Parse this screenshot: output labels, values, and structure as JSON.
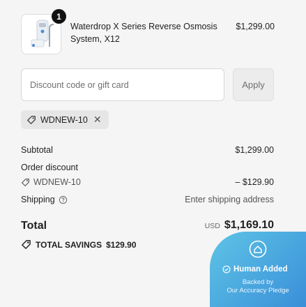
{
  "product": {
    "quantity": "1",
    "name": "Waterdrop X Series Reverse Osmosis System, X12",
    "price": "$1,299.00"
  },
  "discount": {
    "placeholder": "Discount code or gift card",
    "apply_label": "Apply",
    "applied_code": "WDNEW-10",
    "remove_glyph": "✕"
  },
  "summary": {
    "subtotal_label": "Subtotal",
    "subtotal_value": "$1,299.00",
    "order_discount_label": "Order discount",
    "discount_code": "WDNEW-10",
    "discount_value": "– $129.90",
    "shipping_label": "Shipping",
    "shipping_value": "Enter shipping address",
    "total_label": "Total",
    "total_currency": "USD",
    "total_value": "$1,169.10",
    "savings_label": "TOTAL SAVINGS",
    "savings_value": "$129.90"
  },
  "pledge": {
    "title": "Human Added",
    "line1": "Backed by",
    "line2": "Our Accuracy Pledge"
  },
  "icons": {
    "tag": "tag-icon",
    "help": "help-circle-icon",
    "savings": "discount-tag-icon",
    "check": "check-circle-icon",
    "pledge": "pledge-badge-icon"
  }
}
